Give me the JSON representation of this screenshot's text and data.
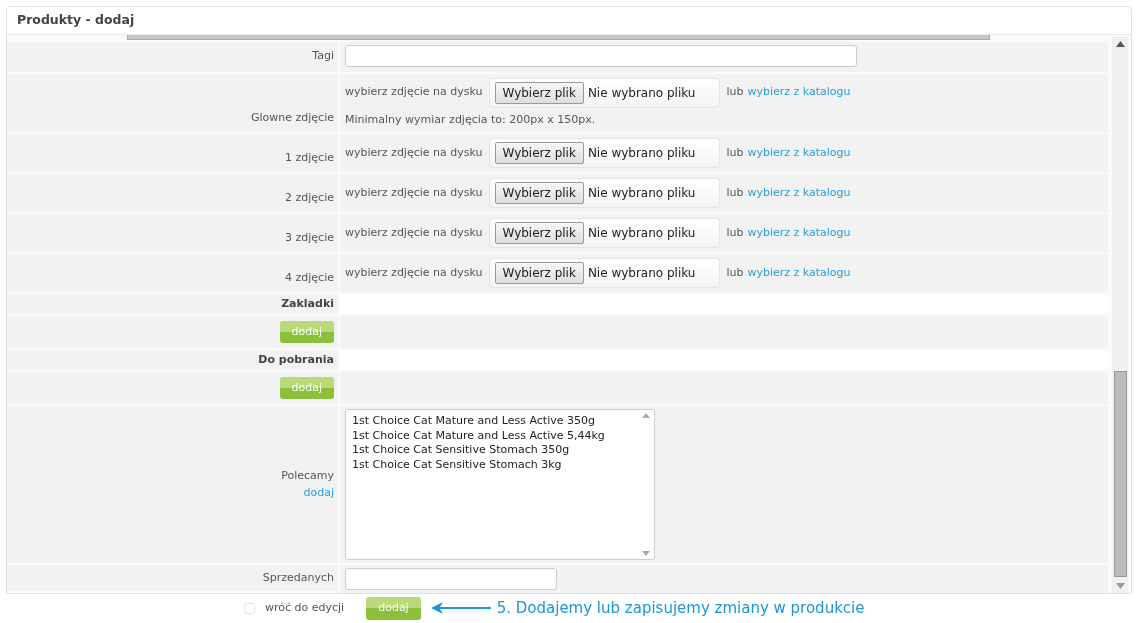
{
  "panel": {
    "title": "Produkty - dodaj"
  },
  "rows": [
    {
      "kind": "text",
      "label": "Tagi"
    },
    {
      "kind": "image",
      "label": "Glowne zdjęcie",
      "disk_label": "wybierz zdjęcie na dysku",
      "file_button": "Wybierz plik",
      "file_status": "Nie wybrano pliku",
      "or": "lub",
      "catalog_link": "wybierz z katalogu",
      "hint": "Minimalny wymiar zdjęcia to: 200px x 150px."
    },
    {
      "kind": "image",
      "label": "1 zdjęcie",
      "disk_label": "wybierz zdjęcie na dysku",
      "file_button": "Wybierz plik",
      "file_status": "Nie wybrano pliku",
      "or": "lub",
      "catalog_link": "wybierz z katalogu"
    },
    {
      "kind": "image",
      "label": "2 zdjęcie",
      "disk_label": "wybierz zdjęcie na dysku",
      "file_button": "Wybierz plik",
      "file_status": "Nie wybrano pliku",
      "or": "lub",
      "catalog_link": "wybierz z katalogu"
    },
    {
      "kind": "image",
      "label": "3 zdjęcie",
      "disk_label": "wybierz zdjęcie na dysku",
      "file_button": "Wybierz plik",
      "file_status": "Nie wybrano pliku",
      "or": "lub",
      "catalog_link": "wybierz z katalogu"
    },
    {
      "kind": "image",
      "label": "4 zdjęcie",
      "disk_label": "wybierz zdjęcie na dysku",
      "file_button": "Wybierz plik",
      "file_status": "Nie wybrano pliku",
      "or": "lub",
      "catalog_link": "wybierz z katalogu"
    },
    {
      "kind": "section",
      "label": "Zakladki"
    },
    {
      "kind": "add",
      "button": "dodaj"
    },
    {
      "kind": "section",
      "label": "Do pobrania"
    },
    {
      "kind": "add",
      "button": "dodaj"
    },
    {
      "kind": "list",
      "label": "Polecamy",
      "link": "dodaj",
      "items": [
        "1st Choice Cat Mature and Less Active 350g",
        "1st Choice Cat Mature and Less Active 5,44kg",
        "1st Choice Cat Sensitive Stomach 350g",
        "1st Choice Cat Sensitive Stomach 3kg"
      ]
    },
    {
      "kind": "number",
      "label": "Sprzedanych"
    }
  ],
  "footer": {
    "checkbox": {
      "label": "wróć do edycji",
      "checked": false
    },
    "submit": "dodaj",
    "annotation": "5. Dodajemy lub zapisujemy zmiany w produkcie"
  }
}
